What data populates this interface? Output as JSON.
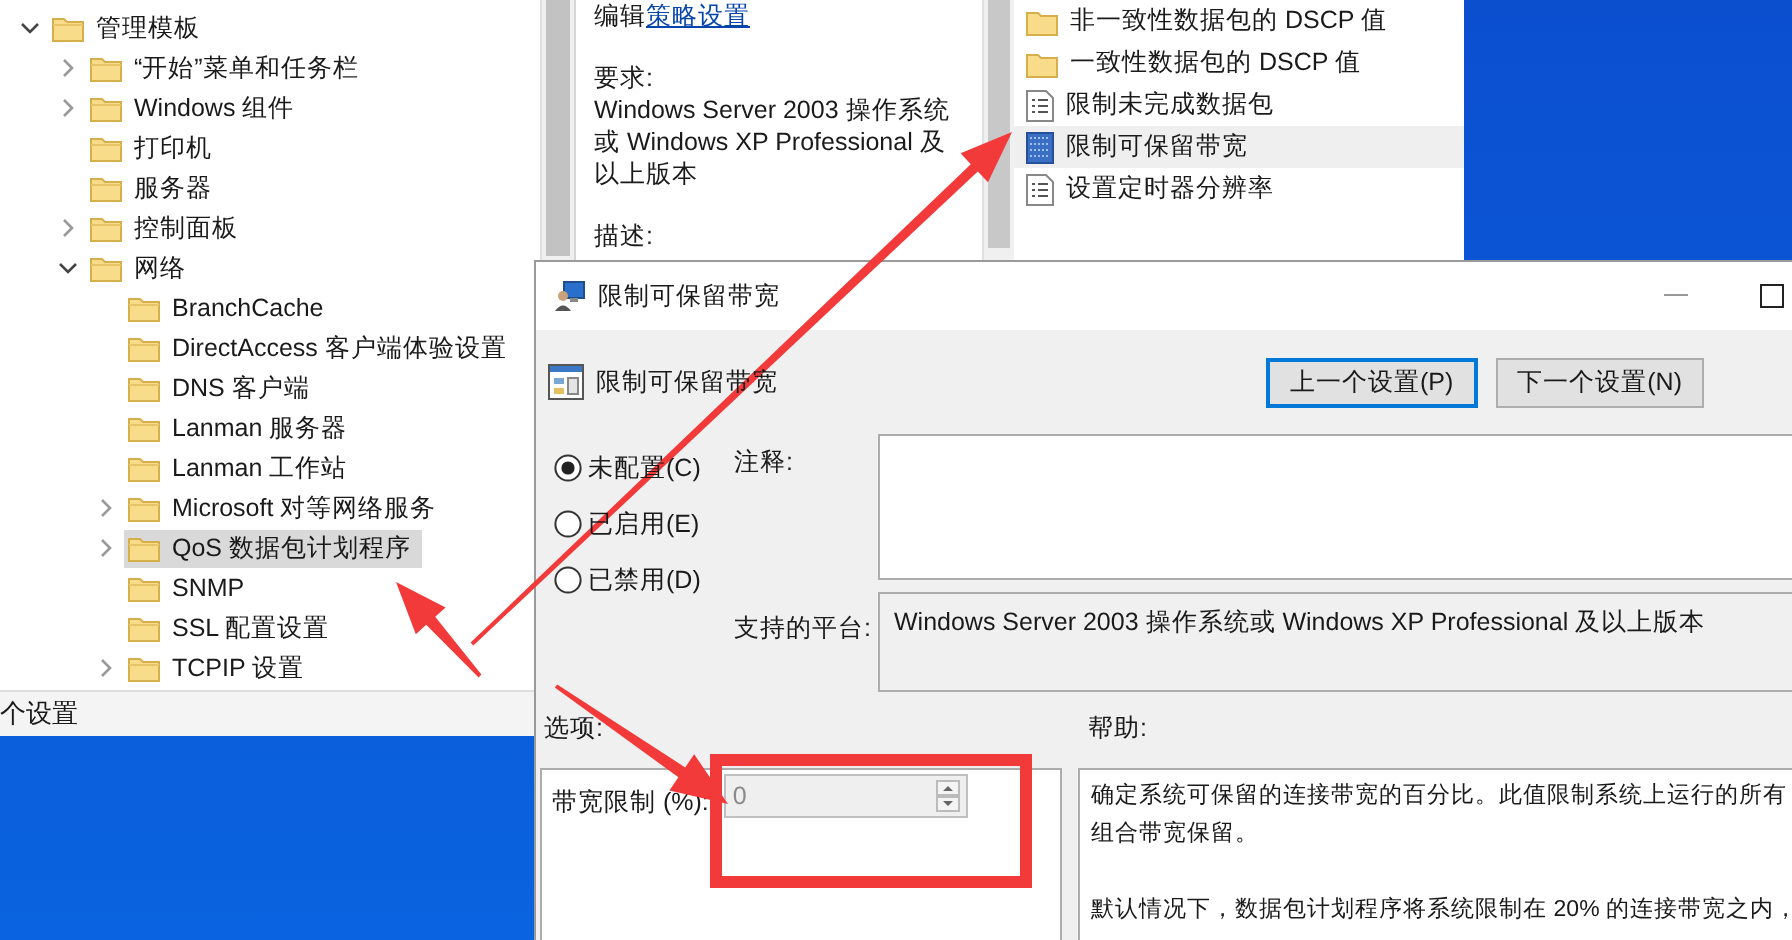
{
  "explorer": {
    "tree": [
      {
        "label": "管理模板",
        "expandable": true,
        "expanded": true,
        "selected": false,
        "children": [
          {
            "label": "“开始”菜单和任务栏",
            "expandable": true,
            "expanded": false,
            "selected": false
          },
          {
            "label": "Windows 组件",
            "expandable": true,
            "expanded": false,
            "selected": false
          },
          {
            "label": "打印机",
            "expandable": false,
            "expanded": false,
            "selected": false
          },
          {
            "label": "服务器",
            "expandable": false,
            "expanded": false,
            "selected": false
          },
          {
            "label": "控制面板",
            "expandable": true,
            "expanded": false,
            "selected": false
          },
          {
            "label": "网络",
            "expandable": true,
            "expanded": true,
            "selected": false,
            "children": [
              {
                "label": "BranchCache",
                "expandable": false,
                "expanded": false,
                "selected": false
              },
              {
                "label": "DirectAccess 客户端体验设置",
                "expandable": false,
                "expanded": false,
                "selected": false
              },
              {
                "label": "DNS 客户端",
                "expandable": false,
                "expanded": false,
                "selected": false
              },
              {
                "label": "Lanman 服务器",
                "expandable": false,
                "expanded": false,
                "selected": false
              },
              {
                "label": "Lanman 工作站",
                "expandable": false,
                "expanded": false,
                "selected": false
              },
              {
                "label": "Microsoft 对等网络服务",
                "expandable": true,
                "expanded": false,
                "selected": false
              },
              {
                "label": "QoS 数据包计划程序",
                "expandable": true,
                "expanded": false,
                "selected": true
              },
              {
                "label": "SNMP",
                "expandable": false,
                "expanded": false,
                "selected": false
              },
              {
                "label": "SSL 配置设置",
                "expandable": false,
                "expanded": false,
                "selected": false
              },
              {
                "label": "TCPIP 设置",
                "expandable": true,
                "expanded": false,
                "selected": false
              }
            ]
          }
        ]
      }
    ],
    "description": {
      "edit_prefix": "编辑",
      "edit_link": "策略设置",
      "requirements_label": "要求:",
      "requirements": "Windows Server 2003 操作系统或 Windows XP Professional 及以上版本",
      "description_label": "描述:"
    },
    "settings": [
      {
        "label": "非一致性数据包的 DSCP 值",
        "kind": "folder",
        "selected": false
      },
      {
        "label": "一致性数据包的 DSCP 值",
        "kind": "folder",
        "selected": false
      },
      {
        "label": "限制未完成数据包",
        "kind": "setting",
        "selected": false
      },
      {
        "label": "限制可保留带宽",
        "kind": "setting",
        "selected": true
      },
      {
        "label": "设置定时器分辨率",
        "kind": "setting",
        "selected": false
      }
    ],
    "status_bar": "个设置"
  },
  "dialog": {
    "title": "限制可保留带宽",
    "heading": "限制可保留带宽",
    "buttons": [
      {
        "label": "上一个设置(P)",
        "focused": true
      },
      {
        "label": "下一个设置(N)",
        "focused": false
      }
    ],
    "states": [
      {
        "label": "未配置(C)",
        "selected": true
      },
      {
        "label": "已启用(E)",
        "selected": false
      },
      {
        "label": "已禁用(D)",
        "selected": false
      }
    ],
    "comment_label": "注释:",
    "platform_label": "支持的平台:",
    "platform": "Windows Server 2003 操作系统或 Windows XP Professional 及以上版本",
    "options_label": "选项:",
    "help_label": "帮助:",
    "options": [
      {
        "label": "带宽限制 (%):",
        "value": "0",
        "disabled": true
      }
    ],
    "help": [
      {
        "lines": [
          "确定系统可保留的连接带宽的百分比。此值限制系统上运行的所有",
          "组合带宽保留。"
        ]
      },
      {
        "lines": [
          "默认情况下，数据包计划程序将系统限制在 20% 的连接带宽之内，"
        ]
      }
    ]
  }
}
